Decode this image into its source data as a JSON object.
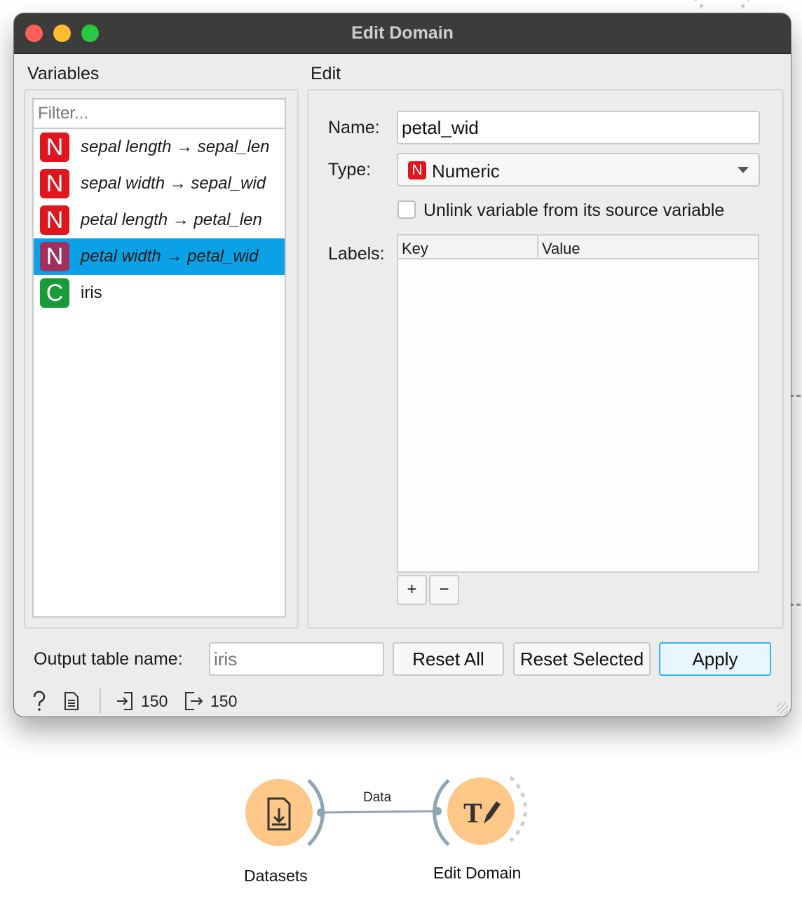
{
  "window": {
    "title": "Edit Domain"
  },
  "variables_panel": {
    "heading": "Variables",
    "filter_placeholder": "Filter...",
    "items": [
      {
        "type_letter": "N",
        "text": "sepal length → sepal_len",
        "selected": false
      },
      {
        "type_letter": "N",
        "text": "sepal width → sepal_wid",
        "selected": false
      },
      {
        "type_letter": "N",
        "text": "petal length → petal_len",
        "selected": false
      },
      {
        "type_letter": "N",
        "text": "petal width → petal_wid",
        "selected": true
      },
      {
        "type_letter": "C",
        "text": "iris",
        "selected": false
      }
    ]
  },
  "edit_panel": {
    "heading": "Edit",
    "name_label": "Name:",
    "name_value": "petal_wid",
    "type_label": "Type:",
    "type_letter": "N",
    "type_value": "Numeric",
    "unlink_label": "Unlink variable from its source variable",
    "unlink_checked": false,
    "labels_label": "Labels:",
    "labels_columns": [
      "Key",
      "Value"
    ],
    "add_label": "+",
    "remove_label": "−"
  },
  "footer": {
    "output_label": "Output table name:",
    "output_value": "iris",
    "reset_all": "Reset All",
    "reset_selected": "Reset Selected",
    "apply": "Apply"
  },
  "status_bar": {
    "input_count": "150",
    "output_count": "150"
  },
  "workflow": {
    "nodes": [
      {
        "label": "Datasets",
        "icon": "file-download-icon"
      },
      {
        "label": "Edit Domain",
        "icon": "text-edit-icon"
      }
    ],
    "link_label": "Data"
  },
  "colors": {
    "selection": "#0ba1e6",
    "numeric": "#e0161e",
    "categorical": "#1a9b3a",
    "node_fill": "#fdc887",
    "apply_border": "#33b0ee"
  }
}
